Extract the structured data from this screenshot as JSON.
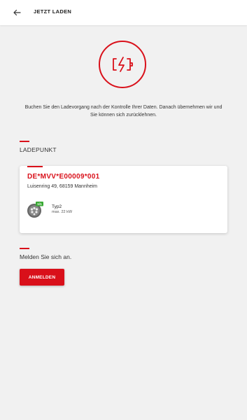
{
  "header": {
    "title": "JETZT LADEN",
    "back_icon": "arrow-left-icon"
  },
  "hero": {
    "icon": "battery-charging-icon",
    "accent_color": "#d9101a",
    "text": "Buchen Sie den Ladevorgang nach der Kontrolle Ihrer Daten. Danach übernehmen wir und Sie können sich zurücklehnen."
  },
  "ladepunkt": {
    "section_label": "LADEPUNKT",
    "id": "DE*MVV*E00009*001",
    "address": "Luisenring 49, 68159 Mannheim",
    "plug": {
      "icon": "type2-plug-icon",
      "availability_badge": "1/1",
      "availability_color": "#3aa935",
      "type": "Typ2",
      "power": "max. 22 kW"
    }
  },
  "login": {
    "prompt": "Melden Sie sich an.",
    "button_label": "ANMELDEN"
  }
}
